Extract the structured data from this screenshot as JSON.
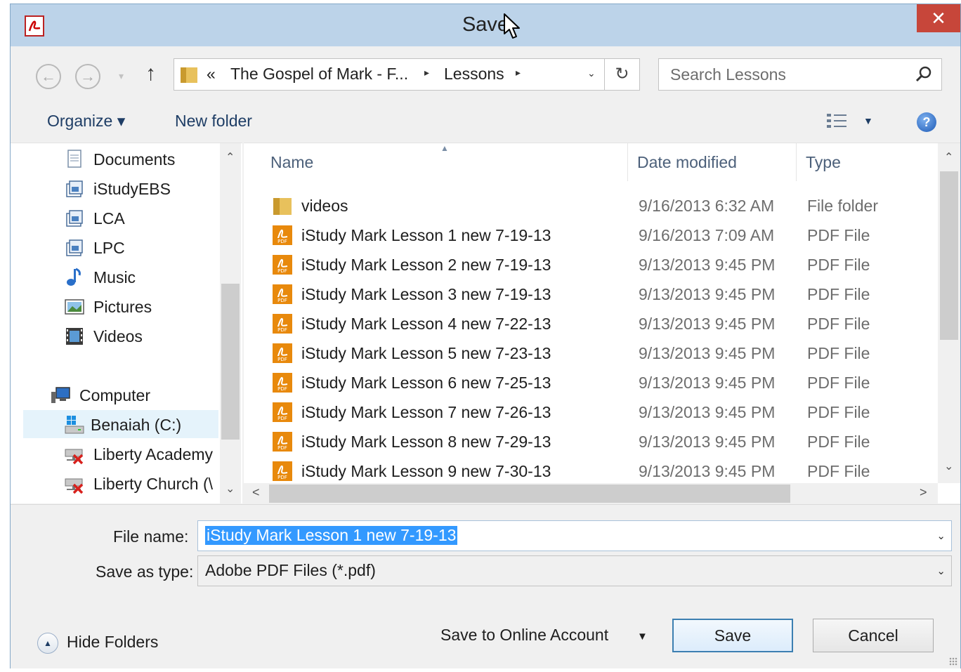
{
  "window": {
    "title": "Save As",
    "title_visible": "Save ",
    "close_glyph": "✕"
  },
  "nav": {
    "back_glyph": "←",
    "forward_glyph": "→",
    "recent_glyph": "▾",
    "up_glyph": "↑",
    "breadcrumb_overflow": "«",
    "breadcrumbs": [
      "The Gospel of Mark - F...",
      "Lessons"
    ],
    "crumb_separator": "▸",
    "dropdown_glyph": "⌄",
    "refresh_glyph": "↻",
    "search_placeholder": "Search Lessons"
  },
  "toolbar": {
    "organize_label": "Organize ▾",
    "new_folder_label": "New folder",
    "view_dropdown_glyph": "▼",
    "help_glyph": "?"
  },
  "nav_pane": {
    "items": [
      {
        "label": "Documents",
        "icon": "documents-icon"
      },
      {
        "label": "iStudyEBS",
        "icon": "library-icon"
      },
      {
        "label": "LCA",
        "icon": "library-icon"
      },
      {
        "label": "LPC",
        "icon": "library-icon"
      },
      {
        "label": "Music",
        "icon": "music-icon"
      },
      {
        "label": "Pictures",
        "icon": "pictures-icon"
      },
      {
        "label": "Videos",
        "icon": "videos-icon"
      },
      {
        "label": "Computer",
        "icon": "computer-icon"
      },
      {
        "label": "Benaiah (C:)",
        "icon": "drive-icon",
        "selected": true
      },
      {
        "label": "Liberty Academy",
        "icon": "network-drive-disconnected-icon"
      },
      {
        "label": "Liberty Church (\\",
        "icon": "network-drive-disconnected-icon"
      }
    ]
  },
  "file_list": {
    "columns": [
      "Name",
      "Date modified",
      "Type"
    ],
    "sort_glyph": "▲",
    "rows": [
      {
        "name": "videos",
        "date": "9/16/2013 6:32 AM",
        "type": "File folder",
        "icon": "folder-icon"
      },
      {
        "name": "iStudy Mark Lesson 1 new 7-19-13",
        "date": "9/16/2013 7:09 AM",
        "type": "PDF File",
        "icon": "pdf-icon"
      },
      {
        "name": "iStudy Mark Lesson 2 new 7-19-13",
        "date": "9/13/2013 9:45 PM",
        "type": "PDF File",
        "icon": "pdf-icon"
      },
      {
        "name": "iStudy Mark Lesson 3 new 7-19-13",
        "date": "9/13/2013 9:45 PM",
        "type": "PDF File",
        "icon": "pdf-icon"
      },
      {
        "name": "iStudy Mark Lesson 4 new 7-22-13",
        "date": "9/13/2013 9:45 PM",
        "type": "PDF File",
        "icon": "pdf-icon"
      },
      {
        "name": "iStudy Mark Lesson 5 new 7-23-13",
        "date": "9/13/2013 9:45 PM",
        "type": "PDF File",
        "icon": "pdf-icon"
      },
      {
        "name": "iStudy Mark Lesson 6 new 7-25-13",
        "date": "9/13/2013 9:45 PM",
        "type": "PDF File",
        "icon": "pdf-icon"
      },
      {
        "name": "iStudy Mark Lesson 7 new 7-26-13",
        "date": "9/13/2013 9:45 PM",
        "type": "PDF File",
        "icon": "pdf-icon"
      },
      {
        "name": "iStudy Mark Lesson 8 new 7-29-13",
        "date": "9/13/2013 9:45 PM",
        "type": "PDF File",
        "icon": "pdf-icon"
      },
      {
        "name": "iStudy Mark Lesson 9 new 7-30-13",
        "date": "9/13/2013 9:45 PM",
        "type": "PDF File",
        "icon": "pdf-icon"
      }
    ]
  },
  "scroll": {
    "up_glyph": "⌃",
    "down_glyph": "⌄",
    "left_glyph": "<",
    "right_glyph": ">"
  },
  "form": {
    "file_name_label": "File name:",
    "file_name_value": "iStudy Mark Lesson 1 new 7-19-13",
    "save_type_label": "Save as type:",
    "save_type_value": "Adobe PDF Files (*.pdf)",
    "dropdown_glyph": "⌄"
  },
  "footer": {
    "hide_folders_label": "Hide Folders",
    "hide_folders_glyph": "▲",
    "online_account_label": "Save to Online Account",
    "online_dropdown_glyph": "▼",
    "save_label": "Save",
    "cancel_label": "Cancel"
  },
  "colors": {
    "titlebar": "#bcd3e9",
    "close": "#c7463a",
    "selection": "#3399ff",
    "pdf_orange": "#e8890c",
    "folder_yellow": "#e8c15c"
  }
}
